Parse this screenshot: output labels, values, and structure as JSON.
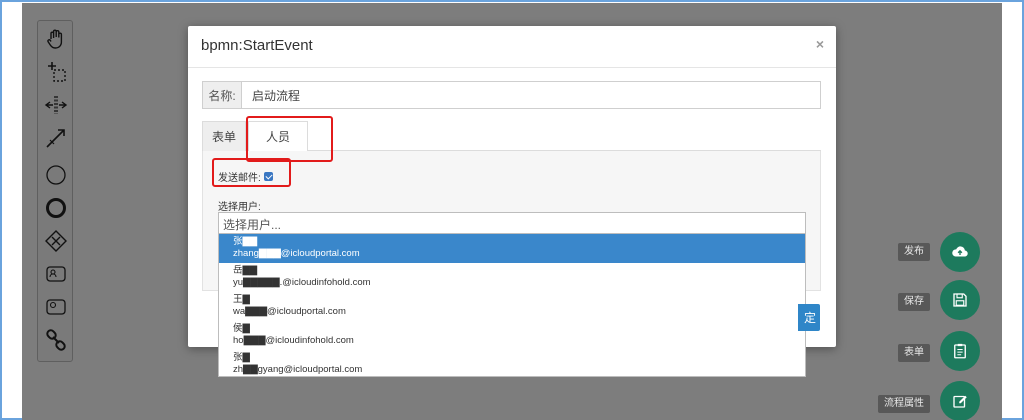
{
  "modal": {
    "title": "bpmn:StartEvent",
    "close": "×",
    "name_label": "名称:",
    "name_value": "启动流程",
    "tabs": [
      {
        "label": "表单",
        "active": false
      },
      {
        "label": "人员",
        "active": true
      }
    ],
    "send_email_label": "发送邮件:",
    "send_email_checked": true,
    "select_user_label": "选择用户:",
    "select_user_placeholder": "选择用户...",
    "users": [
      {
        "name": "张▇▇",
        "email": "zhang▇▇▇@icloudportal.com",
        "highlighted": true
      },
      {
        "name": "岳▇▇",
        "email": "yu▇▇▇▇▇.@icloudinfohold.com",
        "highlighted": false
      },
      {
        "name": "王▇",
        "email": "wa▇▇▇@icloudportal.com",
        "highlighted": false
      },
      {
        "name": "侯▇",
        "email": "ho▇▇▇@icloudinfohold.com",
        "highlighted": false
      },
      {
        "name": "张▇",
        "email": "zh▇▇gyang@icloudportal.com",
        "highlighted": false
      }
    ],
    "confirm_partial": "定"
  },
  "palette": {
    "tools": [
      "hand-tool-icon",
      "lasso-tool-icon",
      "space-tool-icon",
      "connect-tool-icon",
      "start-event-icon",
      "end-event-icon",
      "gateway-icon",
      "user-task-icon",
      "service-task-icon",
      "link-icon"
    ]
  },
  "actions": [
    {
      "label": "发布",
      "icon": "cloud-upload-icon"
    },
    {
      "label": "保存",
      "icon": "save-icon"
    },
    {
      "label": "表单",
      "icon": "clipboard-icon"
    },
    {
      "label": "流程属性",
      "icon": "edit-icon"
    }
  ],
  "colors": {
    "canvas": "#7d7d7d",
    "fab": "#1d7a5d",
    "highlight": "#e21b1b",
    "selected_row": "#3a87cb",
    "frame": "#6aa3dd"
  }
}
